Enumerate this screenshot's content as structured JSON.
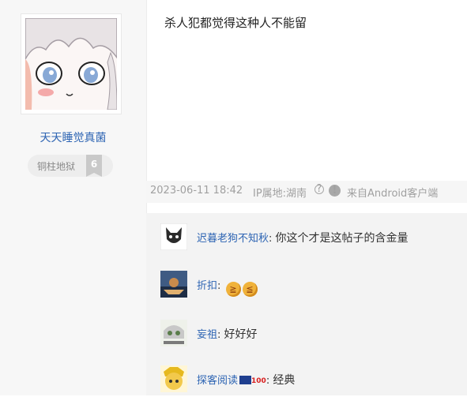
{
  "author": {
    "name": "天天睡觉真菌",
    "level_title": "铜柱地狱",
    "level_number": "6"
  },
  "post": {
    "content": "杀人犯都觉得这种人不能留",
    "time": "2023-06-11 18:42",
    "ip_location": "IP属地:湖南",
    "help_glyph": "?",
    "source": "来自Android客户端"
  },
  "comments": [
    {
      "user": "迟暮老狗不知秋",
      "sep": ": ",
      "text": "你这个才是这帖子的含金量"
    },
    {
      "user": "折扣",
      "sep": ": ",
      "text": ""
    },
    {
      "user": "妄祖",
      "sep": ": ",
      "text": "好好好"
    },
    {
      "user": "探客阅读",
      "sep": ": ",
      "text": "经典"
    }
  ],
  "colors": {
    "link": "#2d64b3",
    "meta_text": "#a0a0a0",
    "left_panel": "#f7f7f7"
  }
}
